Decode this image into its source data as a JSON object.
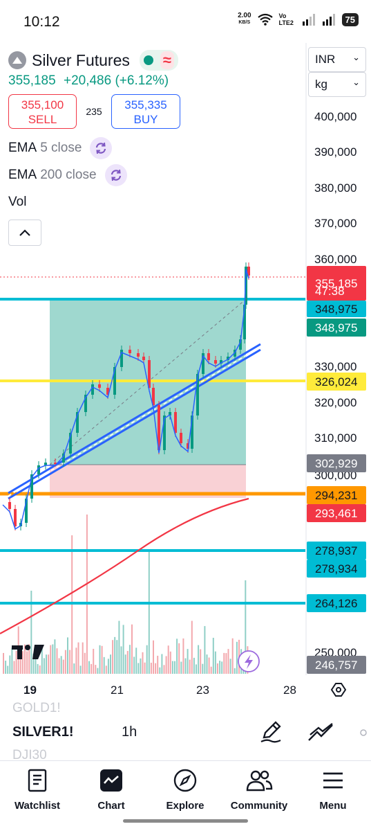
{
  "status_bar": {
    "time": "10:12",
    "speed_value": "2.00",
    "speed_unit": "KB/S",
    "network": "Vo LTE2",
    "battery": "75"
  },
  "symbol": {
    "title": "Silver Futures",
    "price": "355,185",
    "change": "+20,486 (+6.12%)"
  },
  "trade": {
    "sell_price": "355,100",
    "sell_label": "SELL",
    "spread": "235",
    "buy_price": "355,335",
    "buy_label": "BUY"
  },
  "indicators": [
    {
      "name": "EMA",
      "param": "5 close"
    },
    {
      "name": "EMA",
      "param": "200 close"
    },
    {
      "name": "Vol",
      "param": ""
    }
  ],
  "axis": {
    "currency": "INR",
    "unit": "kg",
    "ticks": [
      "400,000",
      "390,000",
      "380,000",
      "370,000",
      "360,000",
      "330,000",
      "320,000",
      "310,000",
      "300,000",
      "250,000"
    ],
    "labels": {
      "last_price": "355,185",
      "countdown": "47:38",
      "cyan_level": "348,975",
      "green_level": "348,975",
      "yellow_level": "326,024",
      "gray_level": "302,929",
      "orange_level": "294,231",
      "red_level": "293,461",
      "teal_level_1": "278,937",
      "teal_level_2": "278,934",
      "teal_level_3": "264,126",
      "bottom_level": "246,757"
    }
  },
  "time_axis": [
    "19",
    "21",
    "23",
    "28"
  ],
  "toolbar": {
    "prev_symbol": "GOLD1!",
    "symbol": "SILVER1!",
    "interval": "1h",
    "next_symbol": "DJI30"
  },
  "nav": {
    "watchlist": "Watchlist",
    "chart": "Chart",
    "explore": "Explore",
    "community": "Community",
    "menu": "Menu"
  },
  "colors": {
    "up": "#089981",
    "down": "#f23645",
    "accent": "#2962ff",
    "highlight": "#ffeb3b",
    "cyan": "#00bcd4",
    "orange": "#ff9800"
  }
}
